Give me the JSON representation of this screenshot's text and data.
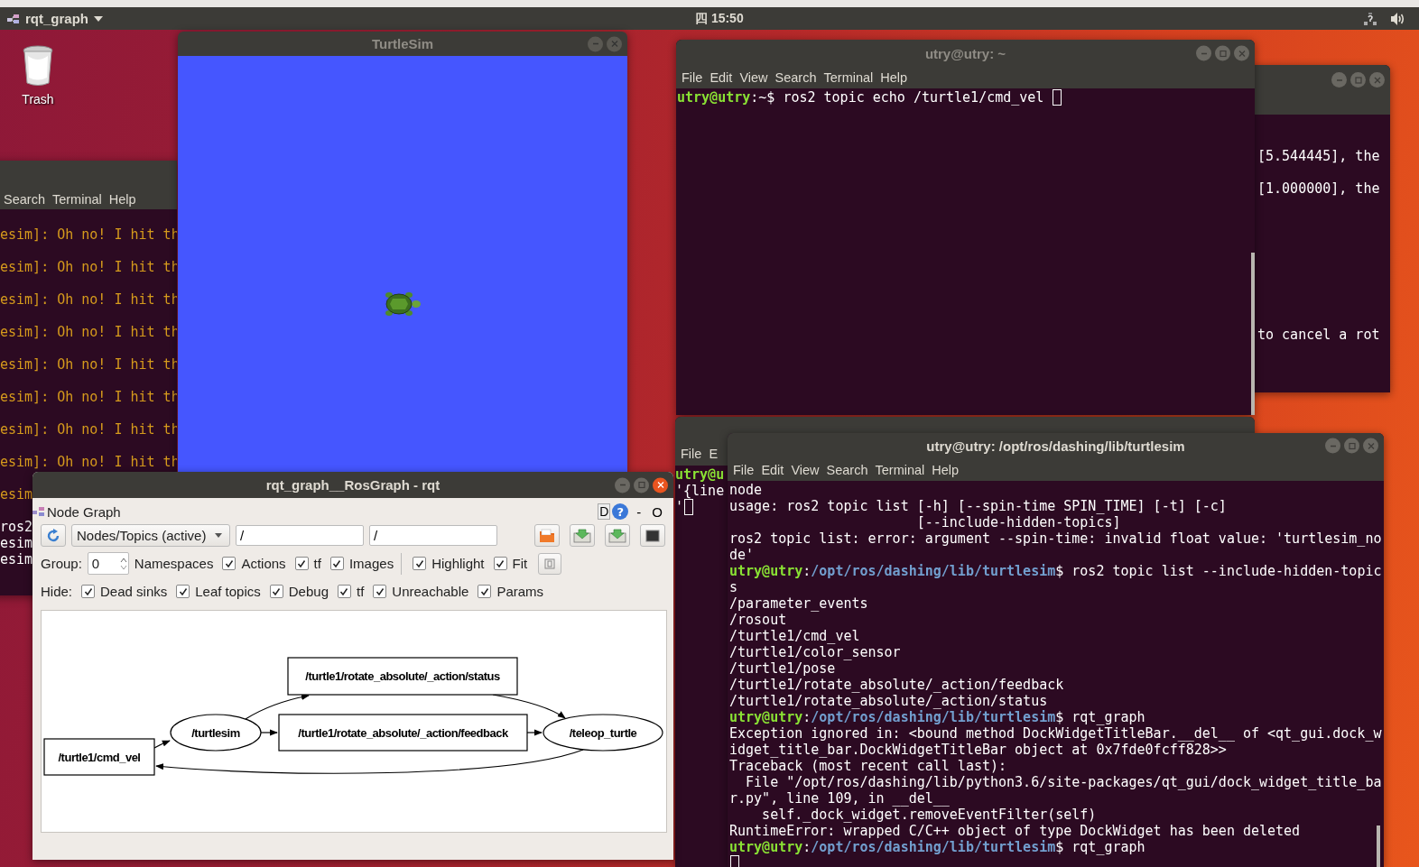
{
  "top_panel": {
    "app_menu": "rqt_graph",
    "clock": "四 15:50"
  },
  "desktop_icons": [
    {
      "label": "Trash"
    }
  ],
  "left_terminal": {
    "menu": [
      "Search",
      "Terminal",
      "Help"
    ],
    "lines": [
      {
        "kind": "warn",
        "text": "esim]: Oh no! I hit th"
      },
      {
        "kind": "warn",
        "text": "esim]: Oh no! I hit th"
      },
      {
        "kind": "warn",
        "text": "esim]: Oh no! I hit th"
      },
      {
        "kind": "warn",
        "text": "esim]: Oh no! I hit th"
      },
      {
        "kind": "warn",
        "text": "esim]: Oh no! I hit th"
      },
      {
        "kind": "warn",
        "text": "esim]: Oh no! I hit th"
      },
      {
        "kind": "warn",
        "text": "esim]: Oh no! I hit th"
      },
      {
        "kind": "warn",
        "text": "esim]: Oh no! I hit th"
      },
      {
        "kind": "warn",
        "text": "esim"
      },
      {
        "kind": "plain",
        "text": "ros2"
      },
      {
        "kind": "plain",
        "text": "esim"
      },
      {
        "kind": "plain",
        "text": "esim"
      }
    ]
  },
  "turtlesim": {
    "title": "TurtleSim"
  },
  "back_terminal": {
    "lines": [
      "[5.544445], the",
      "[1.000000], the",
      "to cancel a rot"
    ]
  },
  "echo_terminal": {
    "title": "utry@utry: ~",
    "menu": [
      "File",
      "Edit",
      "View",
      "Search",
      "Terminal",
      "Help"
    ],
    "lines": [
      {
        "kind": "prompt",
        "user": "utry@utry",
        "sep": ":~",
        "command": "$ ros2 topic echo /turtle1/cmd_vel ",
        "cursor": true
      }
    ]
  },
  "middle_terminal": {
    "menu": [
      "File",
      "E"
    ],
    "lines": [
      {
        "kind": "user",
        "text": "utry@u"
      },
      {
        "kind": "plain",
        "text": "'{line"
      },
      {
        "kind": "plain",
        "text": "'",
        "cursor": true
      }
    ]
  },
  "front_terminal": {
    "title": "utry@utry: /opt/ros/dashing/lib/turtlesim",
    "menu": [
      "File",
      "Edit",
      "View",
      "Search",
      "Terminal",
      "Help"
    ],
    "lines": [
      {
        "kind": "plain",
        "text": "node"
      },
      {
        "kind": "plain",
        "text": "usage: ros2 topic list [-h] [--spin-time SPIN_TIME] [-t] [-c]"
      },
      {
        "kind": "plain",
        "text": "                       [--include-hidden-topics]"
      },
      {
        "kind": "plain",
        "text": "ros2 topic list: error: argument --spin-time: invalid float value: 'turtlesim_no"
      },
      {
        "kind": "plain",
        "text": "de'"
      },
      {
        "kind": "prompt",
        "user": "utry@utry",
        "sep": ":",
        "path": "/opt/ros/dashing/lib/turtlesim",
        "command": "$ ros2 topic list --include-hidden-topic"
      },
      {
        "kind": "plain",
        "text": "s"
      },
      {
        "kind": "plain",
        "text": "/parameter_events"
      },
      {
        "kind": "plain",
        "text": "/rosout"
      },
      {
        "kind": "plain",
        "text": "/turtle1/cmd_vel"
      },
      {
        "kind": "plain",
        "text": "/turtle1/color_sensor"
      },
      {
        "kind": "plain",
        "text": "/turtle1/pose"
      },
      {
        "kind": "plain",
        "text": "/turtle1/rotate_absolute/_action/feedback"
      },
      {
        "kind": "plain",
        "text": "/turtle1/rotate_absolute/_action/status"
      },
      {
        "kind": "prompt",
        "user": "utry@utry",
        "sep": ":",
        "path": "/opt/ros/dashing/lib/turtlesim",
        "command": "$ rqt_graph"
      },
      {
        "kind": "plain",
        "text": "Exception ignored in: <bound method DockWidgetTitleBar.__del__ of <qt_gui.dock_w"
      },
      {
        "kind": "plain",
        "text": "idget_title_bar.DockWidgetTitleBar object at 0x7fde0fcff828>>"
      },
      {
        "kind": "plain",
        "text": "Traceback (most recent call last):"
      },
      {
        "kind": "plain",
        "text": "  File \"/opt/ros/dashing/lib/python3.6/site-packages/qt_gui/dock_widget_title_ba"
      },
      {
        "kind": "plain",
        "text": "r.py\", line 109, in __del__"
      },
      {
        "kind": "plain",
        "text": "    self._dock_widget.removeEventFilter(self)"
      },
      {
        "kind": "plain",
        "text": "RuntimeError: wrapped C/C++ object of type DockWidget has been deleted"
      },
      {
        "kind": "prompt",
        "user": "utry@utry",
        "sep": ":",
        "path": "/opt/ros/dashing/lib/turtlesim",
        "command": "$ rqt_graph"
      },
      {
        "kind": "cursor"
      }
    ]
  },
  "rqt": {
    "title": "rqt_graph__RosGraph - rqt",
    "plugin_title": "Node Graph",
    "debug_button": "D",
    "help_button": "?",
    "dock_controls": [
      "-",
      "O"
    ],
    "graph_mode": "Nodes/Topics (active)",
    "filters": [
      "/",
      "/"
    ],
    "group_label": "Group:",
    "group": "0",
    "namespaces_label": "Namespaces",
    "options": [
      {
        "label": "Actions",
        "checked": true
      },
      {
        "label": "tf",
        "checked": true
      },
      {
        "label": "Images",
        "checked": true
      }
    ],
    "view_options": [
      {
        "label": "Highlight",
        "checked": true
      },
      {
        "label": "Fit",
        "checked": true
      }
    ],
    "hide_label": "Hide:",
    "hide_options": [
      {
        "label": "Dead sinks",
        "checked": true
      },
      {
        "label": "Leaf topics",
        "checked": true
      },
      {
        "label": "Debug",
        "checked": true
      },
      {
        "label": "tf",
        "checked": true
      },
      {
        "label": "Unreachable",
        "checked": true
      },
      {
        "label": "Params",
        "checked": true
      }
    ],
    "graph": {
      "nodes": [
        {
          "kind": "topic",
          "label": "/turtle1/rotate_absolute/_action/status"
        },
        {
          "kind": "node",
          "label": "/turtlesim"
        },
        {
          "kind": "topic",
          "label": "/turtle1/rotate_absolute/_action/feedback"
        },
        {
          "kind": "node",
          "label": "/teleop_turtle"
        },
        {
          "kind": "topic",
          "label": "/turtle1/cmd_vel"
        }
      ]
    }
  }
}
